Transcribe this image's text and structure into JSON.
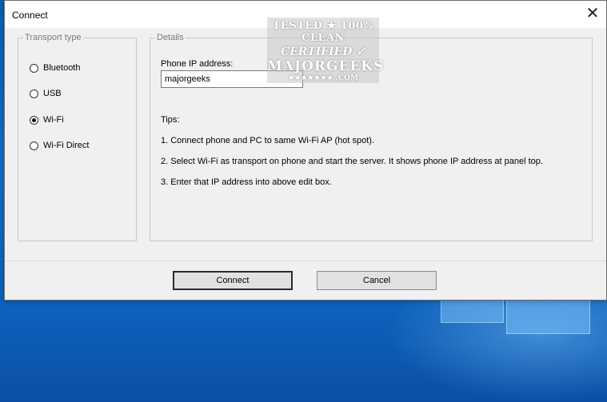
{
  "dialog": {
    "title": "Connect",
    "close_glyph": "✕"
  },
  "transport": {
    "legend": "Transport type",
    "options": [
      {
        "label": "Bluetooth",
        "checked": false
      },
      {
        "label": "USB",
        "checked": false
      },
      {
        "label": "Wi-Fi",
        "checked": true
      },
      {
        "label": "Wi-Fi Direct",
        "checked": false
      }
    ]
  },
  "details": {
    "legend": "Details",
    "ip_label": "Phone IP address:",
    "ip_value": "majorgeeks",
    "tips_heading": "Tips:",
    "tips": [
      "1. Connect phone and PC to same Wi-Fi AP (hot spot).",
      "2. Select Wi-Fi as transport on phone and start the server. It shows phone IP address at panel top.",
      "3. Enter that IP address into above edit box."
    ]
  },
  "buttons": {
    "connect": "Connect",
    "cancel": "Cancel"
  },
  "watermark": {
    "line1": "TESTED ★ 100% CLEAN",
    "line2": "CERTIFIED ✓",
    "line3": "MAJORGEEKS",
    "line4": "★★★★★★★ .COM"
  }
}
